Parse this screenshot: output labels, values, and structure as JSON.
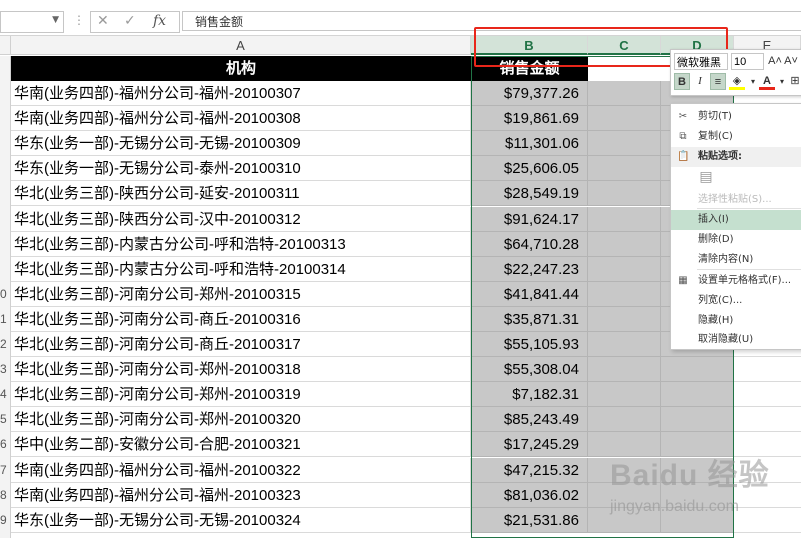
{
  "formula_bar": {
    "name_box": "",
    "formula_value": "销售金额",
    "cancel_icon": "x-icon",
    "enter_icon": "check-icon",
    "function_icon": "fx-icon",
    "fx_glyph": "fx"
  },
  "columns": [
    {
      "letter": "A",
      "selected": false
    },
    {
      "letter": "B",
      "selected": true
    },
    {
      "letter": "C",
      "selected": true
    },
    {
      "letter": "D",
      "selected": true
    },
    {
      "letter": "E",
      "selected": false
    }
  ],
  "table": {
    "headers": [
      "机构",
      "销售金额"
    ],
    "rows": [
      {
        "rownum": "",
        "org": "华南(业务四部)-福州分公司-福州-20100307",
        "amount": "$79,377.26"
      },
      {
        "rownum": "",
        "org": "华南(业务四部)-福州分公司-福州-20100308",
        "amount": "$19,861.69"
      },
      {
        "rownum": "",
        "org": "华东(业务一部)-无锡分公司-无锡-20100309",
        "amount": "$11,301.06"
      },
      {
        "rownum": "",
        "org": "华东(业务一部)-无锡分公司-泰州-20100310",
        "amount": "$25,606.05"
      },
      {
        "rownum": "",
        "org": "华北(业务三部)-陕西分公司-延安-20100311",
        "amount": "$28,549.19"
      },
      {
        "rownum": "",
        "org": "华北(业务三部)-陕西分公司-汉中-20100312",
        "amount": "$91,624.17"
      },
      {
        "rownum": "",
        "org": "华北(业务三部)-内蒙古分公司-呼和浩特-20100313",
        "amount": "$64,710.28"
      },
      {
        "rownum": "",
        "org": "华北(业务三部)-内蒙古分公司-呼和浩特-20100314",
        "amount": "$22,247.23"
      },
      {
        "rownum": "0",
        "org": "华北(业务三部)-河南分公司-郑州-20100315",
        "amount": "$41,841.44"
      },
      {
        "rownum": "1",
        "org": "华北(业务三部)-河南分公司-商丘-20100316",
        "amount": "$35,871.31"
      },
      {
        "rownum": "2",
        "org": "华北(业务三部)-河南分公司-商丘-20100317",
        "amount": "$55,105.93"
      },
      {
        "rownum": "3",
        "org": "华北(业务三部)-河南分公司-郑州-20100318",
        "amount": "$55,308.04"
      },
      {
        "rownum": "4",
        "org": "华北(业务三部)-河南分公司-郑州-20100319",
        "amount": "$7,182.31"
      },
      {
        "rownum": "5",
        "org": "华北(业务三部)-河南分公司-郑州-20100320",
        "amount": "$85,243.49"
      },
      {
        "rownum": "6",
        "org": "华中(业务二部)-安徽分公司-合肥-20100321",
        "amount": "$17,245.29"
      },
      {
        "rownum": "7",
        "org": "华南(业务四部)-福州分公司-福州-20100322",
        "amount": "$47,215.32"
      },
      {
        "rownum": "8",
        "org": "华南(业务四部)-福州分公司-福州-20100323",
        "amount": "$81,036.02"
      },
      {
        "rownum": "9",
        "org": "华东(业务一部)-无锡分公司-无锡-20100324",
        "amount": "$21,531.86"
      }
    ]
  },
  "mini_toolbar": {
    "font_name": "微软雅黑",
    "font_size": "10",
    "grow_font": "A˄",
    "shrink_font": "A˅",
    "bold": "B",
    "italic": "I",
    "fill_icon": "fill-bucket-icon",
    "font_color_glyph": "A"
  },
  "context_menu": {
    "items": [
      {
        "key": "cut",
        "icon": "scissors-icon",
        "label": "剪切(T)"
      },
      {
        "key": "copy",
        "icon": "copy-icon",
        "label": "复制(C)"
      },
      {
        "key": "paste_header",
        "icon": "clipboard-icon",
        "label": "粘贴选项:"
      },
      {
        "key": "paste_special",
        "icon": "",
        "label": "选择性粘贴(S)..."
      },
      {
        "key": "insert",
        "icon": "",
        "label": "插入(I)"
      },
      {
        "key": "delete",
        "icon": "",
        "label": "删除(D)"
      },
      {
        "key": "clear",
        "icon": "",
        "label": "清除内容(N)"
      },
      {
        "key": "format",
        "icon": "format-cells-icon",
        "label": "设置单元格格式(F)..."
      },
      {
        "key": "width",
        "icon": "",
        "label": "列宽(C)..."
      },
      {
        "key": "hide",
        "icon": "",
        "label": "隐藏(H)"
      },
      {
        "key": "unhide",
        "icon": "",
        "label": "取消隐藏(U)"
      }
    ]
  },
  "watermark": {
    "brand": "Baidu 经验",
    "url": "jingyan.baidu.com"
  },
  "colors": {
    "accent": "#217346",
    "annotation": "#e8261a",
    "header_bg": "#000000",
    "selected_fill": "#c8c8c8",
    "menu_highlight": "#c5e0cf"
  }
}
